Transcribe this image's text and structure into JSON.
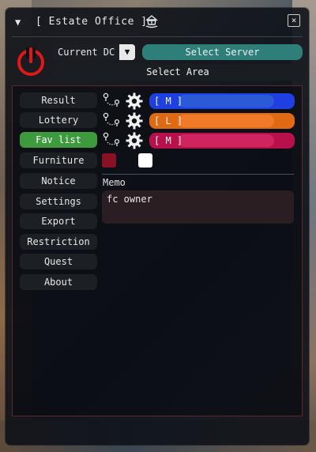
{
  "window": {
    "title": "[ Estate Office ]",
    "collapse_glyph": "▼",
    "close_glyph": "×",
    "title_icon": "house-ship-icon"
  },
  "header": {
    "power_icon": "power-icon",
    "dc_select": {
      "value": "Current DC",
      "arrow": "▼"
    },
    "select_server_label": "Select Server",
    "select_area_label": "Select Area"
  },
  "sidebar": {
    "items": [
      {
        "label": "Result",
        "active": false
      },
      {
        "label": "Lottery",
        "active": false
      },
      {
        "label": "Fav list",
        "active": true
      },
      {
        "label": "Furniture",
        "active": false
      },
      {
        "label": "Notice",
        "active": false
      },
      {
        "label": "Settings",
        "active": false
      },
      {
        "label": "Export",
        "active": false
      },
      {
        "label": "Restriction",
        "active": false
      },
      {
        "label": "Quest",
        "active": false
      },
      {
        "label": "About",
        "active": false
      }
    ]
  },
  "favorites": [
    {
      "label": "[ M ]",
      "bg": "#1f3fe0",
      "fill": "#2a5ad8"
    },
    {
      "label": "[ L ]",
      "bg": "#e06a14",
      "fill": "#f07a2a"
    },
    {
      "label": "[ M ]",
      "bg": "#b8104a",
      "fill": "#d0245e"
    }
  ],
  "colors": {
    "swatch_primary": "#8a1024",
    "swatch_secondary": "#ffffff",
    "accent_active": "#3d9a3d",
    "server_button": "#2e7f7a"
  },
  "memo": {
    "label": "Memo",
    "text": "fc owner"
  }
}
